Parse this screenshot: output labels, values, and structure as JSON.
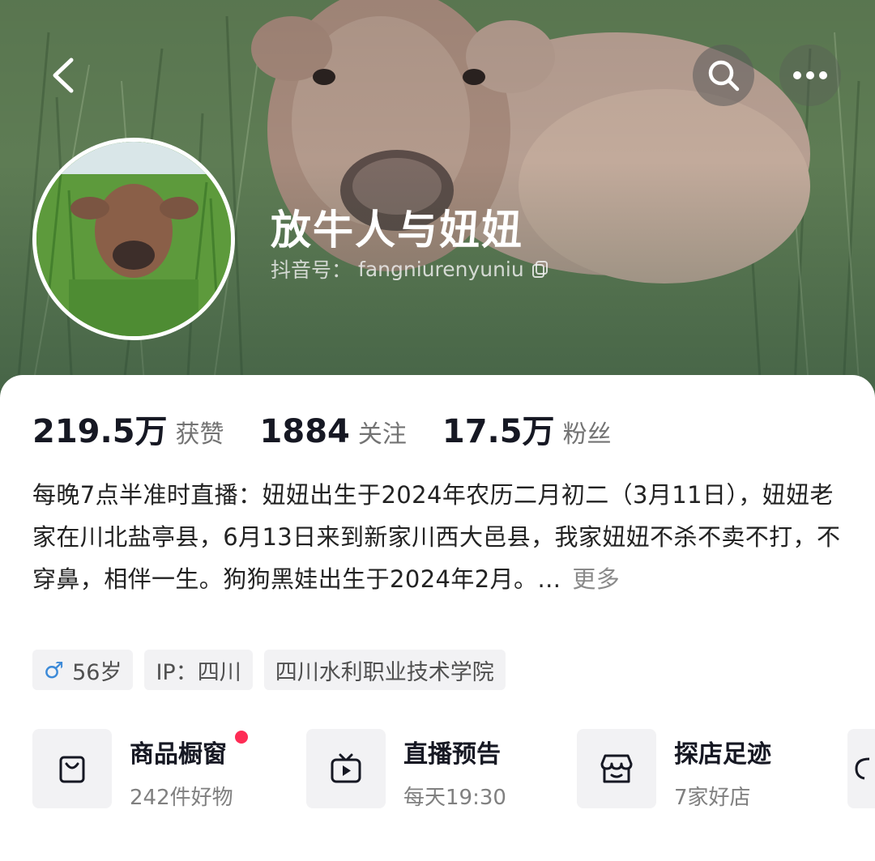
{
  "profile": {
    "nickname": "放牛人与妞妞",
    "account_label": "抖音号：",
    "account_id": "fangniurenyuniu"
  },
  "stats": [
    {
      "value": "219.5万",
      "label": "获赞"
    },
    {
      "value": "1884",
      "label": "关注"
    },
    {
      "value": "17.5万",
      "label": "粉丝"
    }
  ],
  "bio": {
    "text": "每晚7点半准时直播：妞妞出生于2024年农历二月初二（3月11日），妞妞老家在川北盐亭县，6月13日来到新家川西大邑县，我家妞妞不杀不卖不打，不穿鼻，相伴一生。狗狗黑娃出生于2024年2月。...",
    "more": "更多"
  },
  "tags": {
    "gender_symbol": "♂",
    "age": "56岁",
    "ip": "IP：四川",
    "school": "四川水利职业技术学院"
  },
  "services": [
    {
      "title": "商品橱窗",
      "subtitle": "242件好物",
      "icon": "shopping-bag-icon"
    },
    {
      "title": "直播预告",
      "subtitle": "每天19:30",
      "icon": "tv-icon"
    },
    {
      "title": "探店足迹",
      "subtitle": "7家好店",
      "icon": "store-icon"
    }
  ],
  "colors": {
    "accent_dot": "#fe2c55",
    "gender": "#3c8ad8",
    "text_primary": "#161823"
  }
}
